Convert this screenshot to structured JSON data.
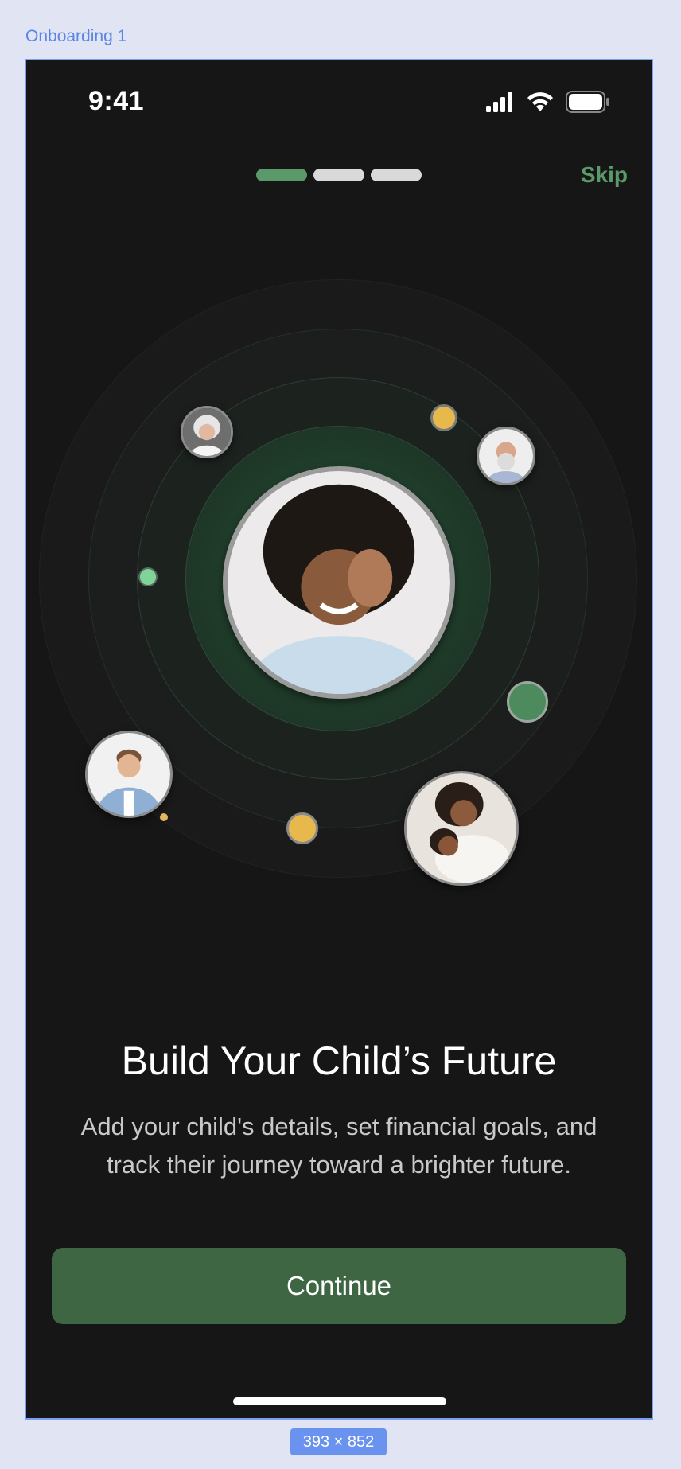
{
  "frame": {
    "label": "Onboarding 1",
    "size_badge": "393 × 852"
  },
  "status_bar": {
    "time": "9:41",
    "icons": [
      "cellular-signal-icon",
      "wifi-icon",
      "battery-icon"
    ]
  },
  "progress": {
    "steps_total": 3,
    "current_step": 1
  },
  "header": {
    "skip_label": "Skip"
  },
  "illustration": {
    "avatars": [
      "child-avatar",
      "elderly-woman-avatar",
      "elderly-man-avatar",
      "young-man-avatar",
      "mother-daughter-avatar"
    ]
  },
  "content": {
    "title": "Build Your Child’s Future",
    "subtitle_line1": "Add your child's details, set financial goals, and",
    "subtitle_line2": "track their journey toward a brighter future."
  },
  "actions": {
    "continue_label": "Continue"
  },
  "colors": {
    "background": "#171617",
    "accent_green": "#5a9a6a",
    "button_green": "#3e6642",
    "dot_yellow": "#e7b84b",
    "dot_light_green": "#7fd49a",
    "frame_outline": "#7a9ef2"
  }
}
